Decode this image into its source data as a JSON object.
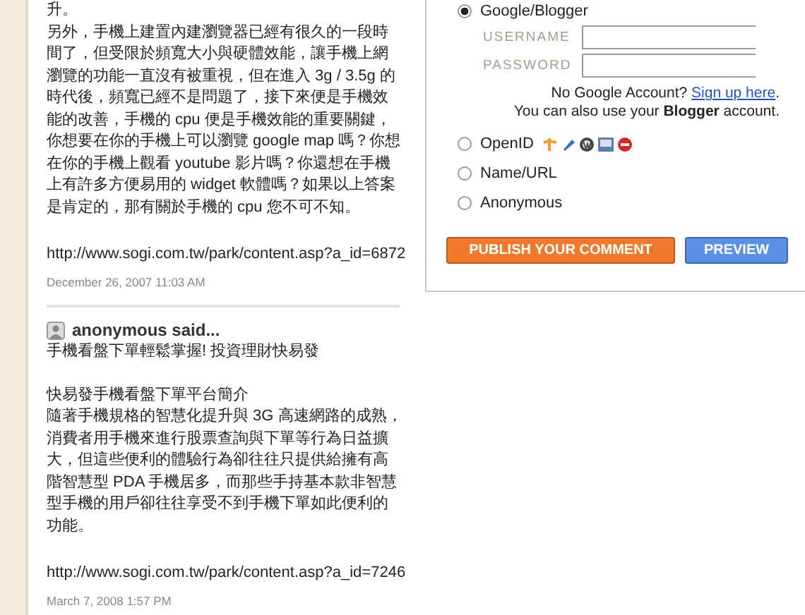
{
  "comments": [
    {
      "body": [
        [
          "升。",
          "另外，手機上建置內建瀏覽器已經有很久的一段時間了，但受限於頻寬大小與硬體效能，讓手機上網瀏覽的功能一直沒有被重視，但在進入 3g / 3.5g 的時代後，頻寬已經不是問題了，接下來便是手機效能的改善，手機的 cpu 便是手機效能的重要關鍵，你想要在你的手機上可以瀏覽 google map 嗎？你想在你的手機上觀看 youtube 影片嗎？你還想在手機上有許多方便易用的 widget 軟體嗎？如果以上答案是肯定的，那有關於手機的 cpu 您不可不知。"
        ]
      ],
      "url": "http://www.sogi.com.tw/park/content.asp?a_id=6872",
      "date": "December 26, 2007 11:03 AM"
    },
    {
      "author": "anonymous said...",
      "body": [
        [
          "手機看盤下單輕鬆掌握! 投資理財快易發"
        ],
        [
          "快易發手機看盤下單平台簡介",
          "隨著手機規格的智慧化提升與 3G 高速網路的成熟，消費者用手機來進行股票查詢與下單等行為日益擴大，但這些便利的體驗行為卻往往只提供給擁有高階智慧型 PDA 手機居多，而那些手持基本款非智慧型手機的用戶卻往往享受不到手機下單如此便利的功能。"
        ]
      ],
      "url": "http://www.sogi.com.tw/park/content.asp?a_id=7246",
      "date": "March 7, 2008 1:57 PM"
    }
  ],
  "identity": {
    "options": [
      {
        "label": "Google/Blogger",
        "selected": true,
        "kind": "google"
      },
      {
        "label": "OpenID",
        "selected": false,
        "kind": "openid"
      },
      {
        "label": "Name/URL",
        "selected": false,
        "kind": "plain"
      },
      {
        "label": "Anonymous",
        "selected": false,
        "kind": "plain"
      }
    ],
    "username_label": "USERNAME",
    "password_label": "PASSWORD",
    "no_account": "No Google Account?",
    "signup_link": "Sign up here",
    "signup_after": ".",
    "also_use": "You can also use your **Blogger** account."
  },
  "buttons": {
    "publish": "PUBLISH YOUR COMMENT",
    "preview": "PREVIEW"
  }
}
